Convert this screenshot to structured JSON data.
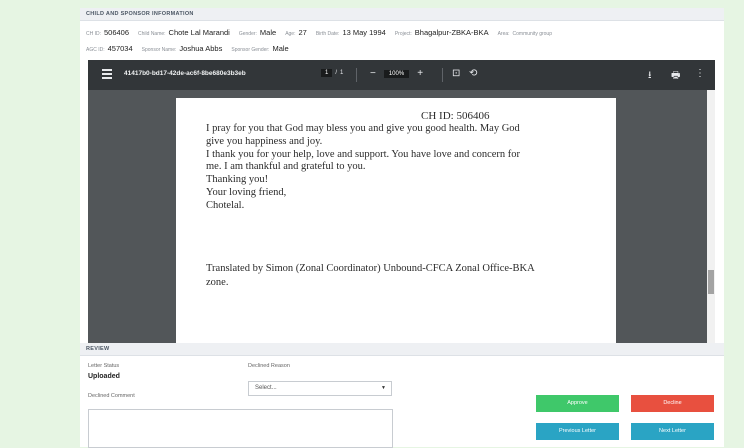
{
  "section_info": {
    "title": "CHILD AND SPONSOR INFORMATION",
    "row1": [
      {
        "label": "CH ID:",
        "value": "506406"
      },
      {
        "label": "Child Name:",
        "value": "Chote Lal Marandi"
      },
      {
        "label": "Gender:",
        "value": "Male"
      },
      {
        "label": "Age:",
        "value": "27"
      },
      {
        "label": "Birth Date:",
        "value": "13 May 1994"
      },
      {
        "label": "Project:",
        "value": "Bhagalpur-ZBKA-BKA"
      },
      {
        "label": "Area:",
        "value": "Community group"
      }
    ],
    "row2": [
      {
        "label": "AGC ID:",
        "value": "457034"
      },
      {
        "label": "Sponsor Name:",
        "value": "Joshua Abbs"
      },
      {
        "label": "Sponsor Gender:",
        "value": "Male"
      }
    ]
  },
  "viewer": {
    "file_name": "41417b0-bd17-42de-ac6f-8be680e3b3eb",
    "page_current": "1",
    "page_total": "1",
    "zoom": "100%",
    "icons": {
      "menu": "hamburger-icon",
      "zoom_out": "−",
      "zoom_in": "+",
      "fit": "⊡",
      "rotate": "⟲",
      "download": "⭳",
      "print": "🖶",
      "more": "⋮"
    }
  },
  "letter": {
    "ch_id": "CH ID: 506406",
    "lines": [
      "I pray for you that God may bless you and give you good health. May God",
      "give you happiness and joy.",
      "I thank you for your help, love and support. You have love and concern for",
      "me. I am thankful and grateful to you.",
      "Thanking you!",
      "Your loving friend,",
      "Chotelal."
    ],
    "translation": [
      "Translated by Simon (Zonal Coordinator) Unbound-CFCA Zonal Office-BKA",
      "zone."
    ]
  },
  "review": {
    "title": "REVIEW",
    "letter_status_label": "Letter Status",
    "letter_status_value": "Uploaded",
    "declined_reason_label": "Declined Reason",
    "declined_reason_value": "Select...",
    "declined_comment_label": "Declined Comment",
    "approve_label": "Approve",
    "decline_label": "Decline",
    "previous_label": "Previous Letter",
    "next_label": "Next Letter"
  },
  "colors": {
    "background": "#e6f5e3",
    "approve": "#3fc86a",
    "decline": "#e8503f",
    "nav": "#2aa4c4",
    "viewer_toolbar": "#323639"
  }
}
